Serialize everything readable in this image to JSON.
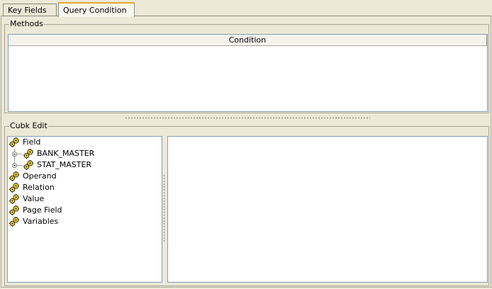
{
  "tabs": [
    {
      "label": "Key Fields"
    },
    {
      "label": "Query Condition"
    }
  ],
  "methods": {
    "legend": "Methods",
    "column_header": "Condition"
  },
  "cubk_edit": {
    "legend": "Cubk Edit",
    "tree": {
      "items": [
        {
          "label": "Field",
          "icon": "gear-cluster-icon"
        },
        {
          "label": "BANK_MASTER",
          "icon": "gear-cluster-icon"
        },
        {
          "label": "STAT_MASTER",
          "icon": "gear-cluster-icon"
        },
        {
          "label": "Operand",
          "icon": "gear-cluster-icon"
        },
        {
          "label": "Relation",
          "icon": "gear-cluster-icon"
        },
        {
          "label": "Value",
          "icon": "gear-cluster-icon"
        },
        {
          "label": "Page Field",
          "icon": "gear-cluster-icon"
        },
        {
          "label": "Variables",
          "icon": "gear-cluster-icon"
        }
      ]
    }
  },
  "colors": {
    "background": "#ece9d8",
    "active_tab_accent": "#e6a53a",
    "panel_border": "#7f9db9"
  }
}
